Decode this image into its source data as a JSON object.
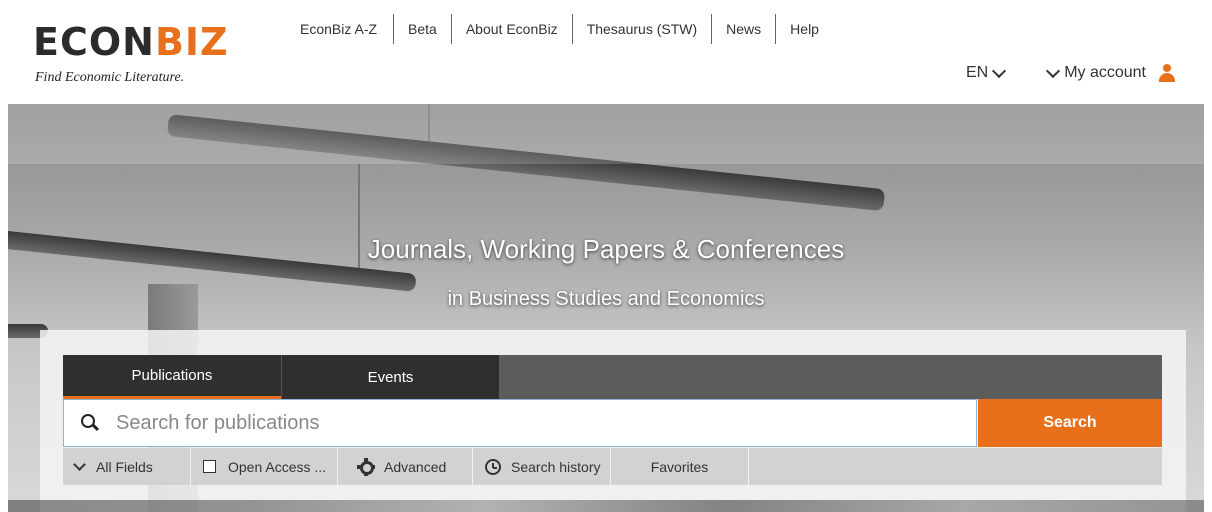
{
  "brand": {
    "name_main": "ECON",
    "name_accent": "BIZ",
    "tagline": "Find Economic Literature."
  },
  "topnav": {
    "items": [
      {
        "label": "EconBiz A-Z"
      },
      {
        "label": "Beta"
      },
      {
        "label": "About EconBiz"
      },
      {
        "label": "Thesaurus (STW)"
      },
      {
        "label": "News"
      },
      {
        "label": "Help"
      }
    ]
  },
  "account": {
    "language": "EN",
    "my_account": "My account",
    "icon": "user-icon",
    "icon_color": "#e8701a"
  },
  "hero": {
    "title": "Journals, Working Papers & Conferences",
    "subtitle": "in Business Studies and Economics"
  },
  "search": {
    "tabs": [
      {
        "label": "Publications",
        "active": true
      },
      {
        "label": "Events",
        "active": false
      }
    ],
    "placeholder": "Search for publications",
    "button_label": "Search",
    "accent_color": "#e8701a",
    "options": {
      "field_select": "All Fields",
      "open_access": "Open Access ...",
      "advanced": "Advanced",
      "history": "Search history",
      "favorites": "Favorites"
    }
  }
}
